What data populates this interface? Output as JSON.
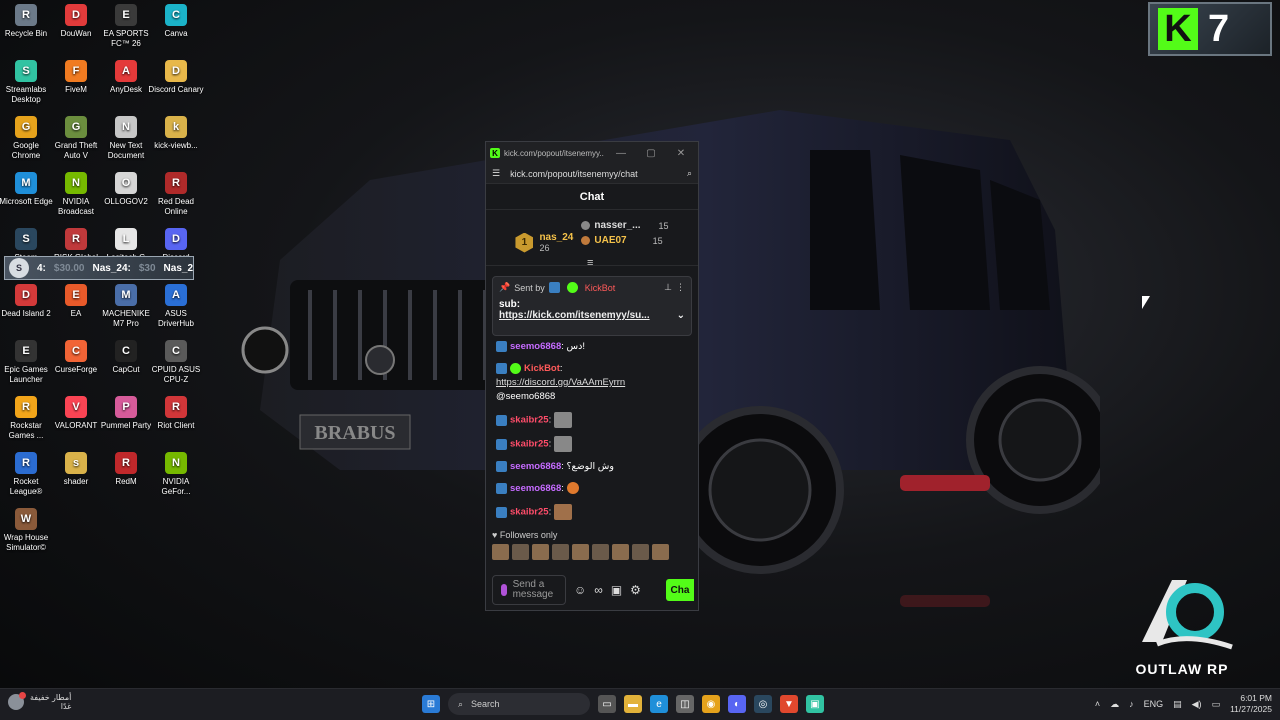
{
  "desktop": {
    "icons": [
      {
        "label": "Recycle Bin",
        "color": "#6c7a89"
      },
      {
        "label": "DouWan",
        "color": "#e23b3b"
      },
      {
        "label": "EA SPORTS FC™ 26",
        "color": "#3a3a3a"
      },
      {
        "label": "Canva",
        "color": "#1bb3c9"
      },
      {
        "label": "Streamlabs Desktop",
        "color": "#31c3a2"
      },
      {
        "label": "FiveM",
        "color": "#f07b21"
      },
      {
        "label": "AnyDesk",
        "color": "#e43a3a"
      },
      {
        "label": "Discord Canary",
        "color": "#e8b84a"
      },
      {
        "label": "Google Chrome",
        "color": "#e5a21c"
      },
      {
        "label": "Grand Theft Auto V",
        "color": "#6b8e3e"
      },
      {
        "label": "New Text Document",
        "color": "#c7c7c7"
      },
      {
        "label": "kick-viewb...",
        "color": "#d9b24a"
      },
      {
        "label": "Microsoft Edge",
        "color": "#1f8fd9"
      },
      {
        "label": "NVIDIA Broadcast",
        "color": "#76b900"
      },
      {
        "label": "OLLOGOV2",
        "color": "#d6d6d6"
      },
      {
        "label": "Red Dead Online",
        "color": "#b02a2a"
      },
      {
        "label": "Steam",
        "color": "#2a475e"
      },
      {
        "label": "RISK Global Domination",
        "color": "#c0393b"
      },
      {
        "label": "Logitech G HUB",
        "color": "#e6e6e6"
      },
      {
        "label": "Discord",
        "color": "#5865f2"
      },
      {
        "label": "Dead Island 2",
        "color": "#d43a3a"
      },
      {
        "label": "EA",
        "color": "#e85a2a"
      },
      {
        "label": "MACHENIKE M7 Pro",
        "color": "#4a6ea8"
      },
      {
        "label": "ASUS DriverHub",
        "color": "#2a6fd6"
      },
      {
        "label": "Epic Games Launcher",
        "color": "#333333"
      },
      {
        "label": "CurseForge",
        "color": "#f16436"
      },
      {
        "label": "CapCut",
        "color": "#222222"
      },
      {
        "label": "CPUID ASUS CPU-Z",
        "color": "#5a5a5a"
      },
      {
        "label": "Rockstar Games ...",
        "color": "#f2a51a"
      },
      {
        "label": "VALORANT",
        "color": "#fa4454"
      },
      {
        "label": "Pummel Party",
        "color": "#d65b9a"
      },
      {
        "label": "Riot Client",
        "color": "#d13639"
      },
      {
        "label": "Rocket League®",
        "color": "#2b6cd1"
      },
      {
        "label": "shader",
        "color": "#d9b24a"
      },
      {
        "label": "RedM",
        "color": "#c0282b"
      },
      {
        "label": "NVIDIA GeFor...",
        "color": "#76b900"
      },
      {
        "label": "Wrap House Simulator©",
        "color": "#8a5a3a"
      }
    ]
  },
  "overlay": {
    "coin": "S",
    "rank": "4:",
    "value": "$30.00",
    "name1": "Nas_24:",
    "value2": "$30",
    "name2": "Nas_2"
  },
  "k7_logo": {
    "k": "K",
    "n": "7"
  },
  "outlaw_logo": {
    "text": "OUTLAW RP"
  },
  "chat_window": {
    "title": "kick.com/popout/itsenemyy...",
    "url": "kick.com/popout/itsenemyy/chat",
    "header": "Chat",
    "leaderboard": {
      "first": {
        "rank": "1",
        "name": "nas_24",
        "count": "26"
      },
      "second": {
        "name": "nasser_...",
        "count": "15"
      },
      "third": {
        "name": "UAE07",
        "count": "15"
      }
    },
    "pinned": {
      "sent_by_label": "Sent by",
      "bot": "KickBot",
      "text": "sub:",
      "link": "https://kick.com/itsenemyy/su..."
    },
    "messages": [
      {
        "user": "seemo6868",
        "text": "دس!",
        "style": "purple"
      },
      {
        "user": "KickBot",
        "text": "",
        "style": "kick",
        "link": "https://discord.gg/VaAAmEyrrn",
        "mention": "@seemo6868"
      },
      {
        "user": "skaibr25",
        "text": "",
        "style": "red",
        "emote": true
      },
      {
        "user": "skaibr25",
        "text": "",
        "style": "red",
        "emote": true
      },
      {
        "user": "seemo6868",
        "text": "وش الوضع؟",
        "style": "purple"
      },
      {
        "user": "seemo6868",
        "text": "",
        "style": "purple",
        "smile": true
      },
      {
        "user": "skaibr25",
        "text": "",
        "style": "red",
        "fist": true
      }
    ],
    "followers_only": "Followers only",
    "input_placeholder": "Send a message",
    "chat_button": "Cha"
  },
  "taskbar": {
    "weather_line1": "أمطار خفيفة",
    "weather_line2": "غدًا",
    "search_label": "Search",
    "lang": "ENG",
    "time": "6:01 PM",
    "date": "11/27/2025"
  }
}
